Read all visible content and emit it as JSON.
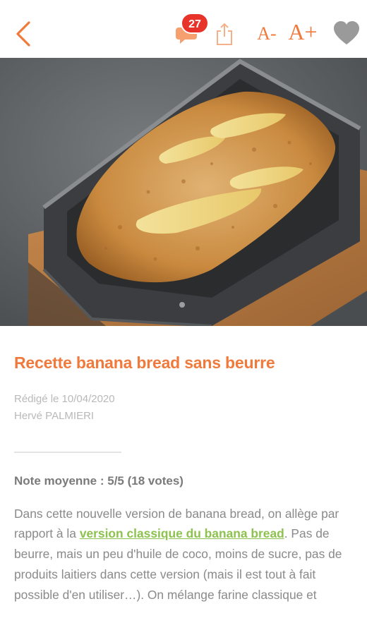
{
  "header": {
    "comment_count": "27",
    "font_decrease_label": "A-",
    "font_increase_label": "A+"
  },
  "article": {
    "title": "Recette banana bread sans beurre",
    "date_line": "Rédigé le 10/04/2020",
    "author": "Hervé PALMIERI",
    "rating": "Note moyenne : 5/5 (18 votes)",
    "body_before_link": "Dans cette nouvelle version de banana bread, on allège par rapport à la ",
    "link_text": "version classique du banana bread",
    "body_after_link": ". Pas de beurre, mais un peu d'huile de coco, moins de sucre, pas de produits laitiers dans cette version (mais il est tout à fait possible d'en utiliser…). On mélange farine classique et"
  },
  "colors": {
    "accent": "#f07a3c",
    "badge": "#e8332b",
    "link": "#8cc24d"
  },
  "icons": [
    "back-chevron-icon",
    "comment-bubble-icon",
    "share-icon",
    "heart-icon"
  ]
}
